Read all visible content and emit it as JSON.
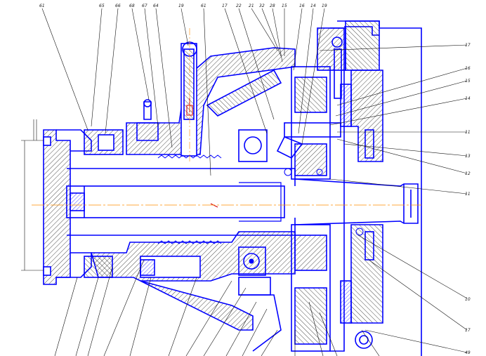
{
  "drawing": {
    "colors": {
      "outline": "#0000ff",
      "leader": "#111111",
      "hatch": "#222222",
      "axis": "#ff8c00",
      "red": "#d40000",
      "fill": "#ffffff"
    },
    "top_callouts": [
      "61",
      "65",
      "66",
      "68",
      "67",
      "64",
      "19",
      "61",
      "17",
      "22",
      "21",
      "32",
      "28",
      "15",
      "16",
      "14",
      "19"
    ],
    "right_callouts": [
      "17",
      "16",
      "15",
      "14",
      "11",
      "13",
      "12",
      "11",
      "10",
      "17",
      "49"
    ]
  }
}
